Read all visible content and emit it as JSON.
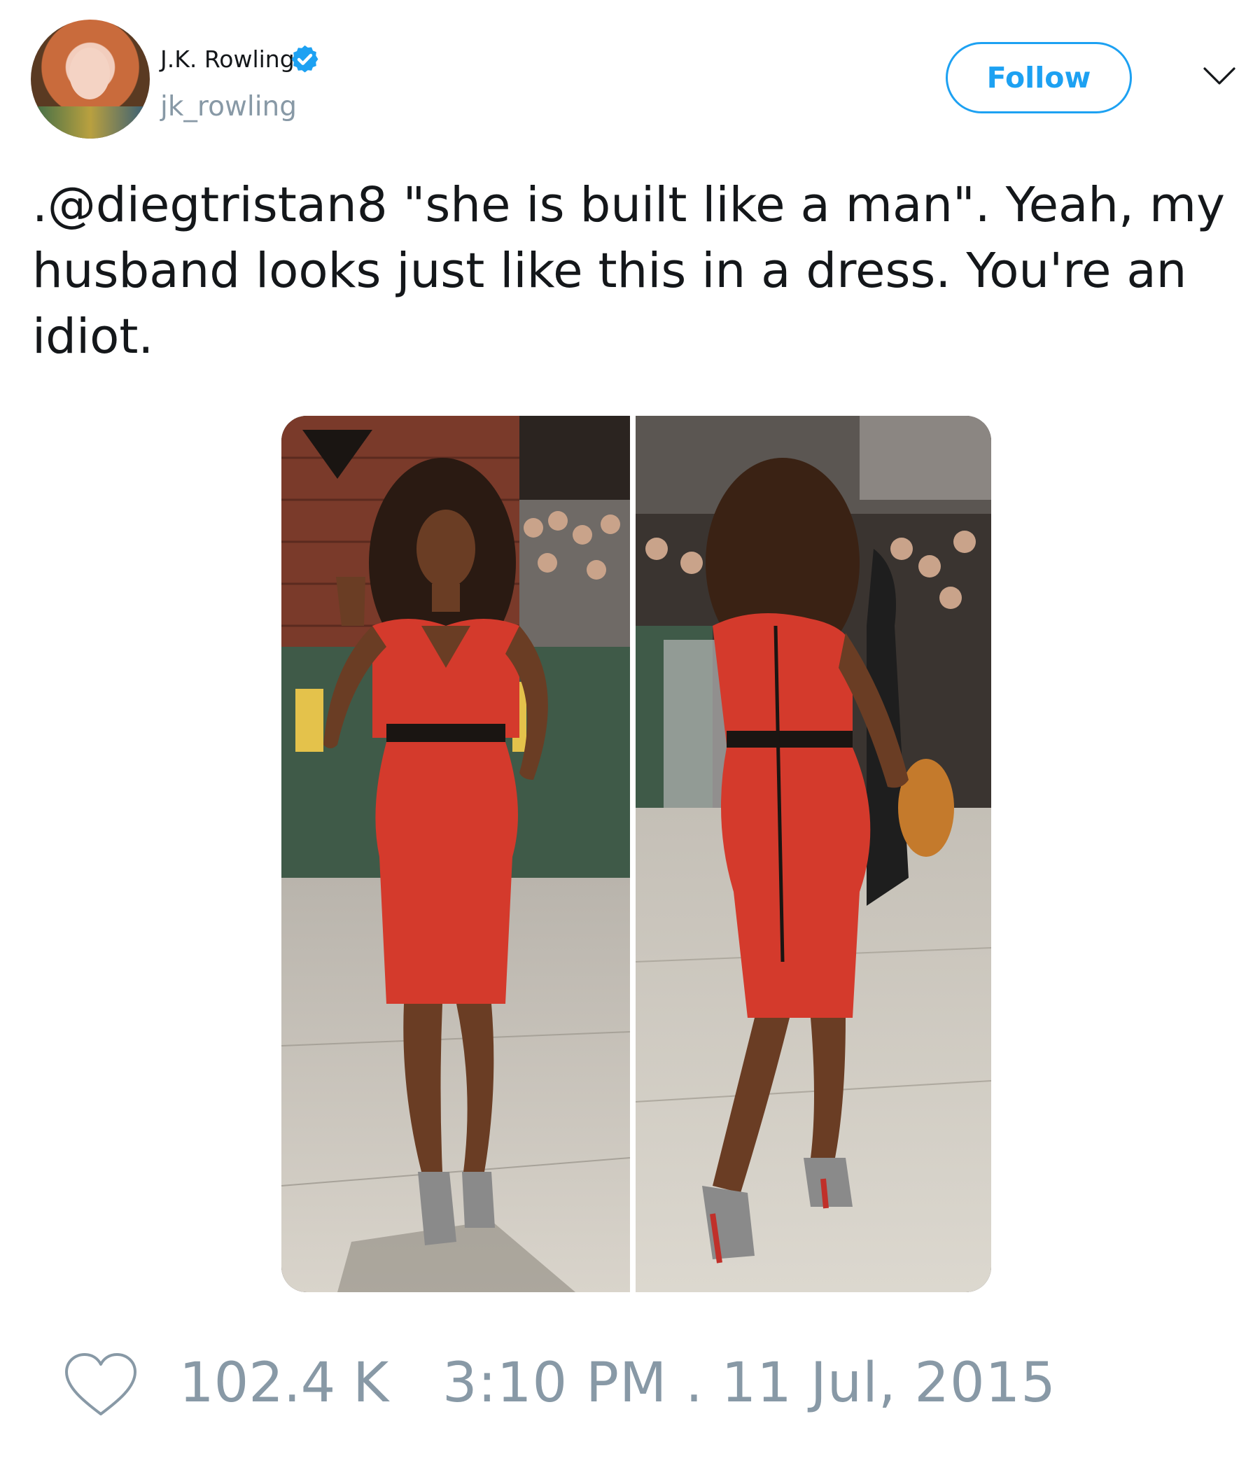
{
  "user": {
    "display_name": "J.K. Rowling",
    "handle": "jk_rowling",
    "verified": true,
    "avatar_icon": "profile-photo"
  },
  "actions": {
    "follow_label": "Follow",
    "more_icon": "chevron-down-icon"
  },
  "tweet": {
    "text": ".@diegtristan8 \"she is built like a man\". Yeah, my husband looks just like this in a dress. You're an idiot."
  },
  "media": {
    "photo_count": 2
  },
  "footer": {
    "like_icon": "heart-outline-icon",
    "like_count": "102.4 K",
    "timestamp": "3:10 PM . 11 Jul, 2015"
  },
  "colors": {
    "accent": "#1da1f2",
    "muted": "#8899a6",
    "text": "#14171a"
  }
}
